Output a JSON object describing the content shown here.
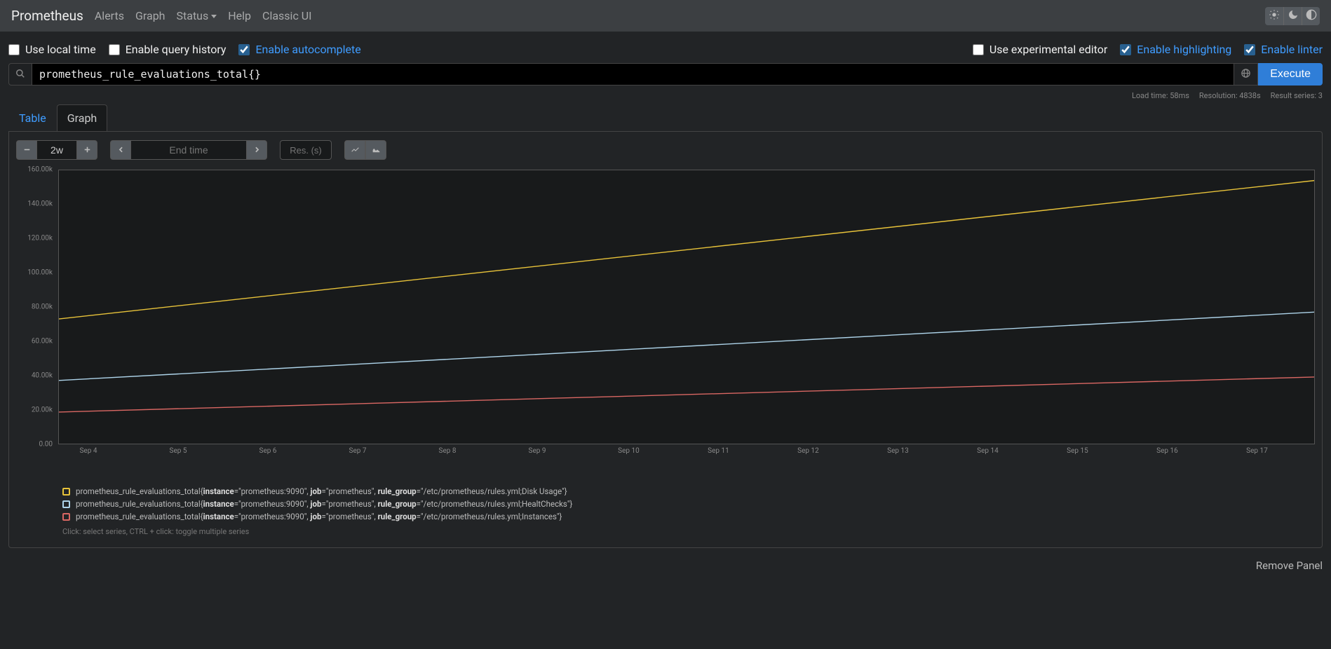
{
  "nav": {
    "brand": "Prometheus",
    "items": [
      "Alerts",
      "Graph",
      "Status",
      "Help",
      "Classic UI"
    ]
  },
  "options": {
    "use_local_time": "Use local time",
    "enable_query_history": "Enable query history",
    "enable_autocomplete": "Enable autocomplete",
    "use_experimental_editor": "Use experimental editor",
    "enable_highlighting": "Enable highlighting",
    "enable_linter": "Enable linter"
  },
  "query": {
    "expression": "prometheus_rule_evaluations_total{}",
    "execute_label": "Execute"
  },
  "stats": {
    "load_time": "Load time: 58ms",
    "resolution": "Resolution: 4838s",
    "series": "Result series: 3"
  },
  "tabs": {
    "table": "Table",
    "graph": "Graph"
  },
  "controls": {
    "range": "2w",
    "end_placeholder": "End time",
    "res_placeholder": "Res. (s)"
  },
  "chart_data": {
    "type": "line",
    "title": "",
    "xlabel": "",
    "ylabel": "",
    "ylim": [
      0,
      160000
    ],
    "x_ticks": [
      "Sep 4",
      "Sep 5",
      "Sep 6",
      "Sep 7",
      "Sep 8",
      "Sep 9",
      "Sep 10",
      "Sep 11",
      "Sep 12",
      "Sep 13",
      "Sep 14",
      "Sep 15",
      "Sep 16",
      "Sep 17"
    ],
    "y_ticks": [
      "0.00",
      "20.00k",
      "40.00k",
      "60.00k",
      "80.00k",
      "100.00k",
      "120.00k",
      "140.00k",
      "160.00k"
    ],
    "x_start": "Sep 3 18:00",
    "x_end": "Sep 17 18:00",
    "series": [
      {
        "name": "Disk Usage",
        "color": "#e8c33a",
        "y_start": 73000,
        "y_end": 154000
      },
      {
        "name": "HealtChecks",
        "color": "#aed4ea",
        "y_start": 37000,
        "y_end": 77000
      },
      {
        "name": "Instances",
        "color": "#d96763",
        "y_start": 18500,
        "y_end": 39000
      }
    ]
  },
  "legend": {
    "hint": "Click: select series, CTRL + click: toggle multiple series",
    "rows": [
      {
        "color": "#e8c33a",
        "metric": "prometheus_rule_evaluations_total",
        "instance": "prometheus:9090",
        "job": "prometheus",
        "rule_group": "/etc/prometheus/rules.yml;Disk Usage"
      },
      {
        "color": "#aed4ea",
        "metric": "prometheus_rule_evaluations_total",
        "instance": "prometheus:9090",
        "job": "prometheus",
        "rule_group": "/etc/prometheus/rules.yml;HealtChecks"
      },
      {
        "color": "#d96763",
        "metric": "prometheus_rule_evaluations_total",
        "instance": "prometheus:9090",
        "job": "prometheus",
        "rule_group": "/etc/prometheus/rules.yml;Instances"
      }
    ]
  },
  "footer": {
    "remove_panel": "Remove Panel"
  }
}
